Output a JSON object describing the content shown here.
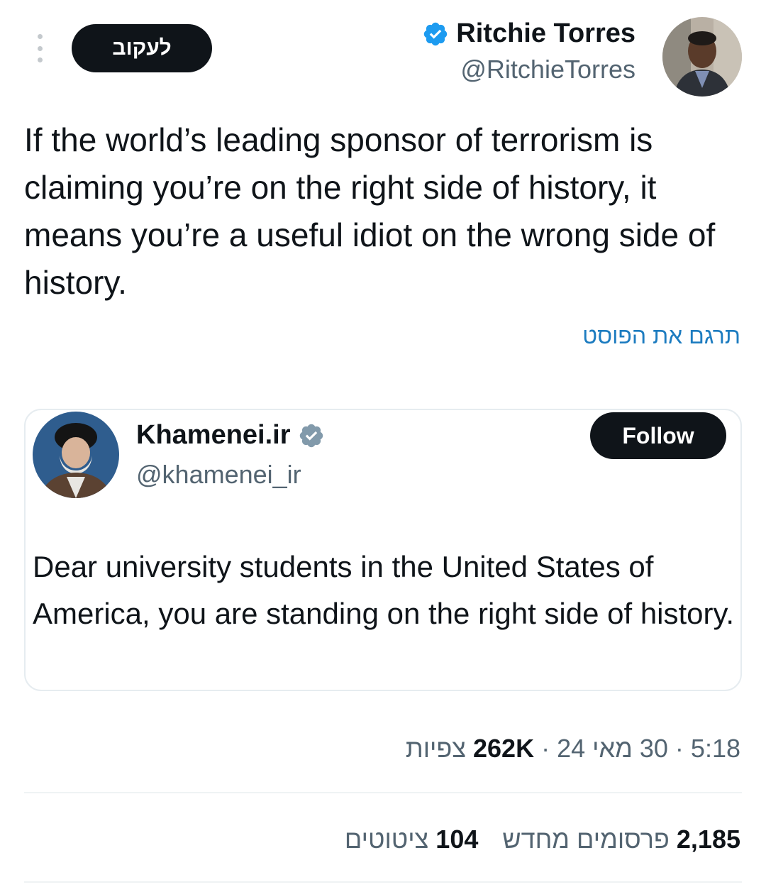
{
  "header": {
    "follow_label": "לעקוב",
    "author_name": "Ritchie Torres",
    "author_handle": "@RitchieTorres"
  },
  "post": {
    "text": "If the world’s leading sponsor of terrorism is claiming you’re on the right side of history, it means you’re a useful idiot on the wrong side of history.",
    "translate_label": "תרגם את הפוסט"
  },
  "quoted": {
    "author_name": "Khamenei.ir",
    "author_handle": "@khamenei_ir",
    "follow_label": "Follow",
    "text": "Dear university students in the United States of America, you are standing on the right side of history."
  },
  "meta": {
    "time": "5:18",
    "date": "30 מאי 24",
    "views_count": "262K",
    "views_label": "צפיות",
    "separator": "·"
  },
  "stats": {
    "reposts_count": "2,185",
    "reposts_label": "פרסומים מחדש",
    "quotes_count": "104",
    "quotes_label": "ציטוטים"
  },
  "colors": {
    "verified": "#1d9bf0",
    "verified_gray": "#829aab",
    "link": "#1d7cc0",
    "button": "#0f1419"
  },
  "icons": [
    "more-vertical-icon",
    "verified-badge-icon",
    "verified-gray-badge-icon"
  ]
}
